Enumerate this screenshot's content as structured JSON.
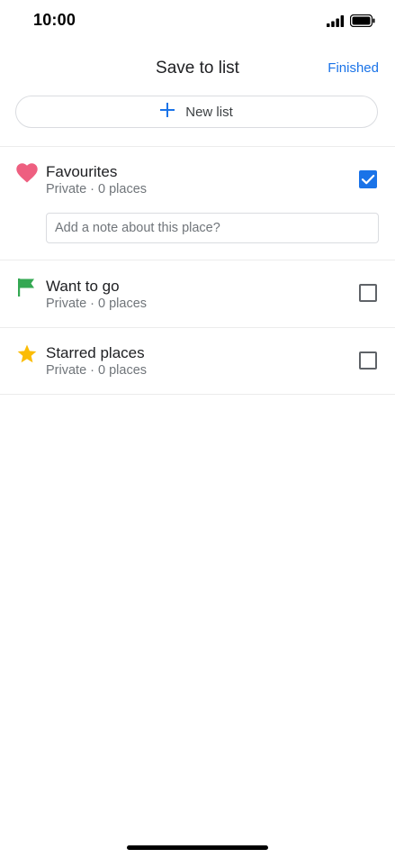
{
  "status_bar": {
    "time": "10:00"
  },
  "header": {
    "title": "Save to list",
    "finished_label": "Finished"
  },
  "new_list": {
    "label": "New list"
  },
  "lists": [
    {
      "title": "Favourites",
      "subtitle": "Private · 0 places",
      "icon": "heart-icon",
      "icon_color": "#ee5f80",
      "checked": true,
      "note_placeholder": "Add a note about this place?"
    },
    {
      "title": "Want to go",
      "subtitle": "Private · 0 places",
      "icon": "flag-icon",
      "icon_color": "#34a853",
      "checked": false
    },
    {
      "title": "Starred places",
      "subtitle": "Private · 0 places",
      "icon": "star-icon",
      "icon_color": "#fbbc04",
      "checked": false
    }
  ],
  "colors": {
    "accent": "#1a73e8",
    "divider": "#ececec"
  }
}
